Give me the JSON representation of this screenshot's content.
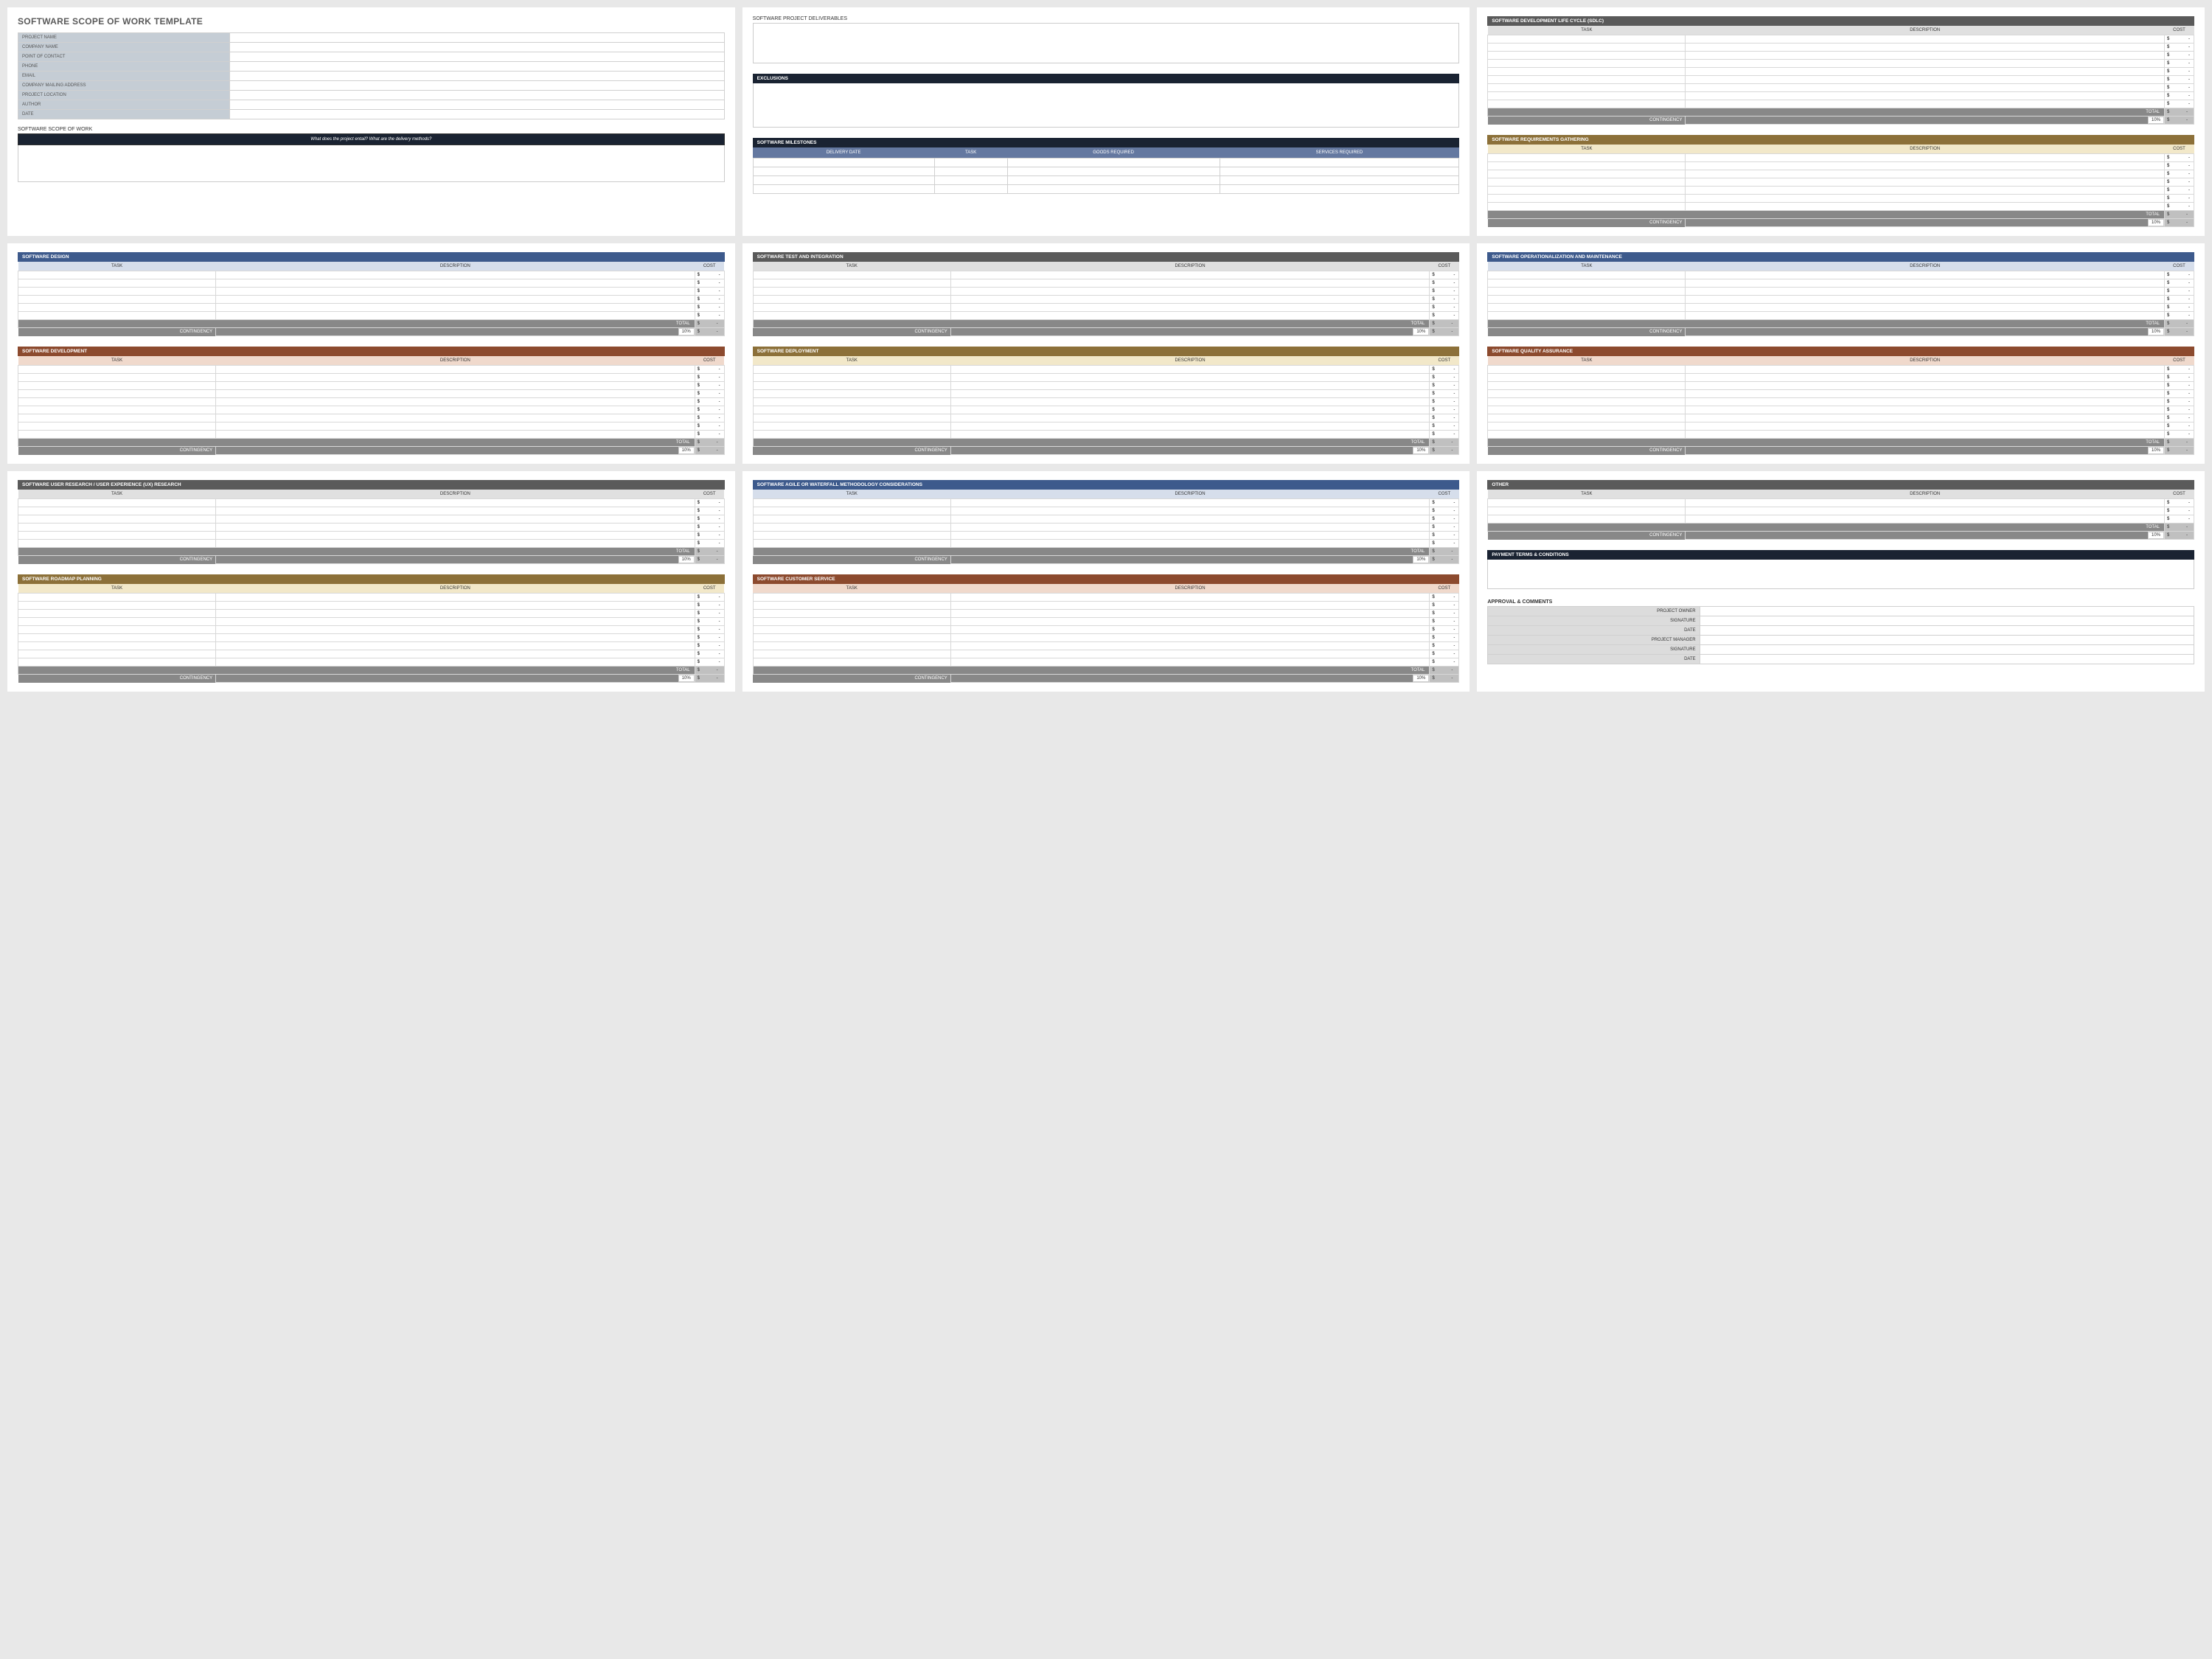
{
  "title": "SOFTWARE SCOPE OF WORK TEMPLATE",
  "meta_fields": [
    "PROJECT NAME",
    "COMPANY NAME",
    "POINT OF CONTACT",
    "PHONE",
    "EMAIL",
    "COMPANY MAILING ADDRESS",
    "PROJECT LOCATION",
    "AUTHOR",
    "DATE"
  ],
  "scope_section": {
    "label": "SOFTWARE SCOPE OF WORK",
    "banner": "What does the project entail? What are the delivery methods?"
  },
  "deliverables_label": "SOFTWARE PROJECT DELIVERABLES",
  "exclusions_label": "EXCLUSIONS",
  "milestones": {
    "label": "SOFTWARE MILESTONES",
    "cols": [
      "DELIVERY DATE",
      "TASK",
      "GOODS REQUIRED",
      "SERVICES REQUIRED"
    ]
  },
  "common": {
    "task": "TASK",
    "desc": "DESCRIPTION",
    "cost": "COST",
    "total": "TOTAL",
    "cont": "CONTINGENCY",
    "pct": "10%",
    "dollar": "$",
    "dash": "-"
  },
  "tables": {
    "sdlc": {
      "title": "SOFTWARE DEVELOPMENT LIFE CYCLE (SDLC)",
      "style": "grey",
      "head": "lightgrey",
      "rows": 9
    },
    "req": {
      "title": "SOFTWARE REQUIREMENTS GATHERING",
      "style": "gold",
      "head": "cream",
      "rows": 7
    },
    "design": {
      "title": "SOFTWARE DESIGN",
      "style": "blue",
      "head": "lightblue",
      "rows": 6
    },
    "dev": {
      "title": "SOFTWARE DEVELOPMENT",
      "style": "rust",
      "head": "peach",
      "rows": 9
    },
    "test": {
      "title": "SOFTWARE TEST AND INTEGRATION",
      "style": "grey",
      "head": "lightgrey",
      "rows": 6
    },
    "deploy": {
      "title": "SOFTWARE DEPLOYMENT",
      "style": "gold",
      "head": "cream",
      "rows": 9
    },
    "ops": {
      "title": "SOFTWARE OPERATIONALIZATION AND MAINTENANCE",
      "style": "blue",
      "head": "lightblue",
      "rows": 6
    },
    "qa": {
      "title": "SOFTWARE QUALITY ASSURANCE",
      "style": "rust",
      "head": "peach",
      "rows": 9
    },
    "ux": {
      "title": "SOFTWARE USER RESEARCH / USER EXPERIENCE (UX) RESEARCH",
      "style": "grey",
      "head": "lightgrey",
      "rows": 6
    },
    "roadmap": {
      "title": "SOFTWARE ROADMAP PLANNING",
      "style": "gold",
      "head": "cream",
      "rows": 9
    },
    "agile": {
      "title": "SOFTWARE AGILE OR WATERFALL METHODOLOGY CONSIDERATIONS",
      "style": "blue",
      "head": "lightblue",
      "rows": 6
    },
    "custserv": {
      "title": "SOFTWARE CUSTOMER SERVICE",
      "style": "rust",
      "head": "peach",
      "rows": 9
    },
    "other": {
      "title": "OTHER",
      "style": "grey",
      "head": "lightgrey",
      "rows": 3
    }
  },
  "payment_label": "PAYMENT TERMS & CONDITIONS",
  "approval": {
    "title": "APPROVAL & COMMENTS",
    "fields": [
      "PROJECT OWNER",
      "SIGNATURE",
      "DATE",
      "PROJECT MANAGER",
      "SIGNATURE",
      "DATE"
    ]
  }
}
